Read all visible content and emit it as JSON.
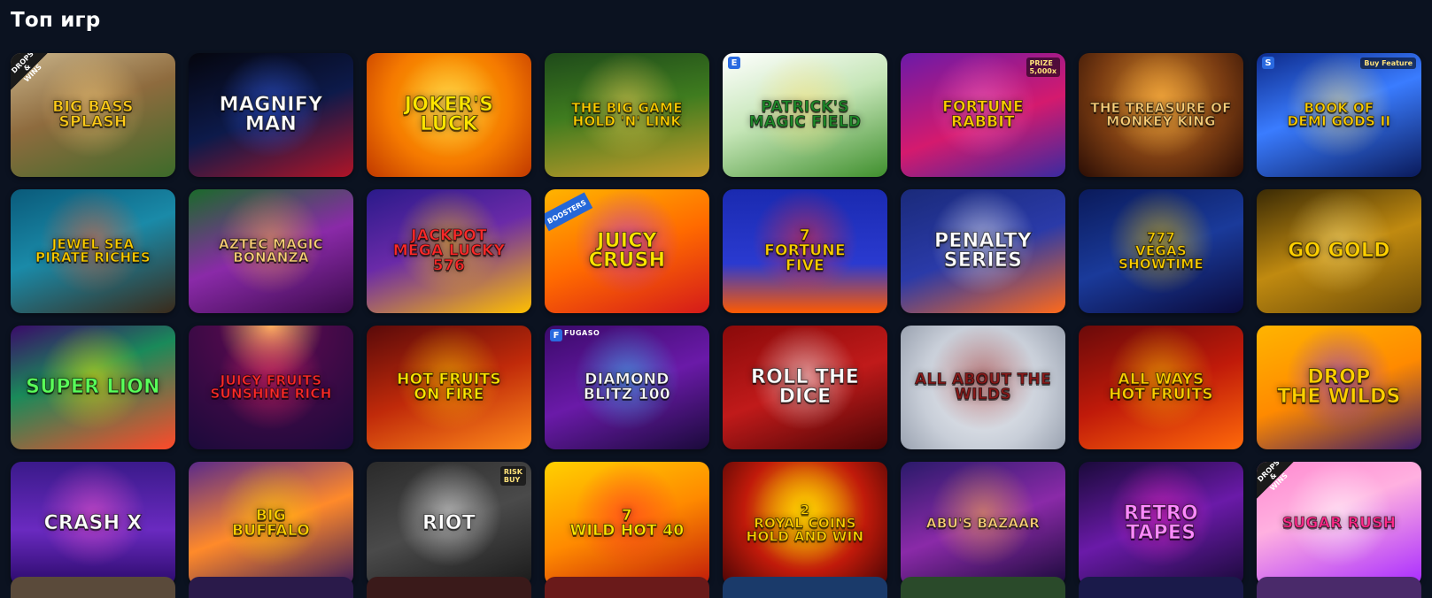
{
  "section": {
    "title": "Топ игр"
  },
  "games": [
    {
      "name": "BIG BASS\nSPLASH",
      "size": "small",
      "bg": "linear-gradient(160deg,#c9b48a 0%,#8e6b3e 45%,#3d6b2a 100%)",
      "glow": "#ffd27a",
      "color": "#ffcc1a",
      "badge": "DROPS\n& WINS"
    },
    {
      "name": "MAGNIFY\nMAN",
      "size": "normal",
      "bg": "linear-gradient(160deg,#05060e 0%,#0d1a4a 50%,#b01427 100%)",
      "glow": "#3a66ff",
      "color": "#ffffff"
    },
    {
      "name": "JOKER'S\nLUCK",
      "size": "normal",
      "bg": "radial-gradient(circle at 50% 40%,#ffb400 0%,#f57a00 55%,#c03800 100%)",
      "glow": "#fff08a",
      "color": "#ffe600"
    },
    {
      "name": "THE BIG GAME\nHOLD 'N' LINK",
      "size": "xs",
      "bg": "linear-gradient(170deg,#1e4a1a 0%,#3f7c1f 45%,#c69a2a 100%)",
      "glow": "#ffd65a",
      "color": "#ffd000"
    },
    {
      "name": "PATRICK'S\nMagic Field",
      "size": "small",
      "bg": "linear-gradient(160deg,#ffffff 0%,#c6e6b8 45%,#3f8f2d 100%)",
      "glow": "#ffe27a",
      "color": "#1f8a2a",
      "provider": "E"
    },
    {
      "name": "FORTUNE\nRabbit",
      "size": "small",
      "bg": "linear-gradient(160deg,#6b1aa8 0%,#d41a6e 55%,#3a2aa0 100%)",
      "glow": "#ff6ec7",
      "color": "#ffd000",
      "topright": "PRIZE\n5,000x"
    },
    {
      "name": "THE TREASURE OF\nMONKEY KING",
      "size": "xs",
      "bg": "radial-gradient(circle at 50% 35%,#d58b2a 0%,#7a3c12 55%,#2a0d05 100%)",
      "glow": "#ffb347",
      "color": "#ffd27a"
    },
    {
      "name": "BOOK OF\nDEMI GODS II",
      "size": "xs",
      "bg": "linear-gradient(160deg,#0d2a8a 0%,#3a7cff 45%,#0a1a5a 100%)",
      "glow": "#ffe27a",
      "color": "#ffd000",
      "provider": "S",
      "topright": "Buy Feature"
    },
    {
      "name": "JEWEL SEA\nPIRATE RICHES",
      "size": "xs",
      "bg": "linear-gradient(160deg,#0a5a7a 0%,#1a8aa8 45%,#3a2a1a 100%)",
      "glow": "#ff5a2a",
      "color": "#ffd000"
    },
    {
      "name": "AZTEC MAGIC\nBONANZA",
      "size": "xs",
      "bg": "linear-gradient(160deg,#1a6a2a 0%,#8a2aa8 50%,#3a0a4a 100%)",
      "glow": "#ffb347",
      "color": "#ffd27a"
    },
    {
      "name": "JACKPOT\nMEGA LUCKY\n576",
      "size": "small",
      "bg": "linear-gradient(160deg,#2a1a8a 0%,#6a2aa8 45%,#ffc000 100%)",
      "glow": "#ffd000",
      "color": "#ff2a2a"
    },
    {
      "name": "Juicy\nCRUSH",
      "size": "normal",
      "bg": "linear-gradient(160deg,#ffb400 0%,#ff6a00 50%,#d41a1a 100%)",
      "glow": "#a82aff",
      "color": "#ffe600",
      "cornerbadge": "BOOSTERS"
    },
    {
      "name": "7\nFORTUNE\nFIVE",
      "size": "small",
      "bg": "linear-gradient(180deg,#1a2ab0 0%,#2a3ad0 60%,#ff5a00 100%)",
      "glow": "#ff2a2a",
      "color": "#ffd000"
    },
    {
      "name": "PENALTY\nSERIES",
      "size": "normal",
      "bg": "linear-gradient(160deg,#1a2a7a 0%,#2a3aa8 50%,#ff6a1a 100%)",
      "glow": "#ffffff",
      "color": "#ffffff"
    },
    {
      "name": "777\nVEGAS\nShowtime",
      "size": "xs",
      "bg": "linear-gradient(160deg,#0a1a5a 0%,#1a3a9a 50%,#0a0a3a 100%)",
      "glow": "#ffd000",
      "color": "#ffd000"
    },
    {
      "name": "GO GOLD",
      "size": "normal",
      "bg": "linear-gradient(160deg,#3a2a05 0%,#c08a10 50%,#6a4a08 100%)",
      "glow": "#ffe27a",
      "color": "#ffd000"
    },
    {
      "name": "SUPER LION",
      "size": "normal",
      "bg": "linear-gradient(160deg,#3a0a6a 0%,#1a8a5a 40%,#ff4a2a 100%)",
      "glow": "#ffe600",
      "color": "#5aff5a"
    },
    {
      "name": "Juicy Fruits\nSunshine Rich",
      "size": "xs",
      "bg": "radial-gradient(circle at 50% 0%,#ffb060 0%,#4a0a4a 35%,#1a0a3a 100%)",
      "glow": "#ff2a6a",
      "color": "#ff2a2a"
    },
    {
      "name": "HOT FRUITS\nON FIRE",
      "size": "small",
      "bg": "linear-gradient(160deg,#5a0a0a 0%,#c02a0a 50%,#ff8a1a 100%)",
      "glow": "#ffd000",
      "color": "#ffe600"
    },
    {
      "name": "DIAMOND\nBLITZ 100",
      "size": "small",
      "bg": "linear-gradient(160deg,#3a0a6a 0%,#6a1aa8 50%,#1a0a3a 100%)",
      "glow": "#3ad0ff",
      "color": "#ffffff",
      "provider": "F",
      "providertext": "FUGASO"
    },
    {
      "name": "ROLL THE\nDICE",
      "size": "normal",
      "bg": "linear-gradient(160deg,#8a0a0a 0%,#c01a1a 50%,#4a0505 100%)",
      "glow": "#ffffff",
      "color": "#ffffff"
    },
    {
      "name": "ALL ABOUT THE\nWILDS",
      "size": "small",
      "bg": "radial-gradient(circle at 50% 50%,#f0f2f6 0%,#c8ced8 60%,#9aa2b0 100%)",
      "glow": "#8a1a1a",
      "color": "#8a1a1a"
    },
    {
      "name": "ALL WAYS\nHOT FRUITS",
      "size": "small",
      "bg": "linear-gradient(160deg,#6a0a0a 0%,#c01a0a 50%,#ff6a0a 100%)",
      "glow": "#ffd000",
      "color": "#ffd000"
    },
    {
      "name": "DROP\nTHE WILDS",
      "size": "normal",
      "bg": "linear-gradient(160deg,#ffb400 0%,#ff8a00 50%,#3a1a6a 100%)",
      "glow": "#6a2aff",
      "color": "#ffd000"
    },
    {
      "name": "CRASH X",
      "size": "normal",
      "bg": "linear-gradient(180deg,#3a1a8a 0%,#6a2ac0 55%,#2a0a6a 100%)",
      "glow": "#ff5ad0",
      "color": "#ffffff"
    },
    {
      "name": "BIG\nBUFFALO",
      "size": "small",
      "bg": "linear-gradient(160deg,#5a2a8a 0%,#ff8a2a 50%,#3a1a5a 100%)",
      "glow": "#ffd000",
      "color": "#ffd000"
    },
    {
      "name": "RiOT",
      "size": "normal",
      "bg": "linear-gradient(160deg,#2a2a2a 0%,#4a4a4a 50%,#1a1a1a 100%)",
      "glow": "#ffffff",
      "color": "#ffffff",
      "topright": "RISK\nBUY"
    },
    {
      "name": "7\nWILD HOT 40",
      "size": "small",
      "bg": "linear-gradient(160deg,#ffd000 0%,#ff8a00 50%,#c01a0a 100%)",
      "glow": "#ff2a2a",
      "color": "#ffe600"
    },
    {
      "name": "2\nROYAL COINS\nHOLD AND WIN",
      "size": "xs",
      "bg": "radial-gradient(circle at 50% 40%,#ffd000 0%,#c01a0a 55%,#4a0505 100%)",
      "glow": "#ffd000",
      "color": "#ffd000"
    },
    {
      "name": "ABU'S BAZAAR",
      "size": "xs",
      "bg": "linear-gradient(160deg,#2a1a6a 0%,#8a2aa8 50%,#1a0a3a 100%)",
      "glow": "#ffb347",
      "color": "#ffd27a"
    },
    {
      "name": "RETRO\nTAPES",
      "size": "normal",
      "bg": "linear-gradient(160deg,#1a0a3a 0%,#6a1aa8 50%,#1a0a3a 100%)",
      "glow": "#ff2ad0",
      "color": "#ff8aff"
    },
    {
      "name": "Sugar Rush",
      "size": "small",
      "bg": "linear-gradient(160deg,#ff8ad0 0%,#ffb0e0 40%,#a82aff 100%)",
      "glow": "#ffffff",
      "color": "#ff2a8a",
      "badge": "DROPS\n& WINS"
    }
  ],
  "next_row_colors": [
    "#5a4a3a",
    "#2a1a4a",
    "#3a1a1a",
    "#6a1a1a",
    "#1a3a6a",
    "#2a4a2a",
    "#1a1a4a",
    "#4a2a6a"
  ]
}
